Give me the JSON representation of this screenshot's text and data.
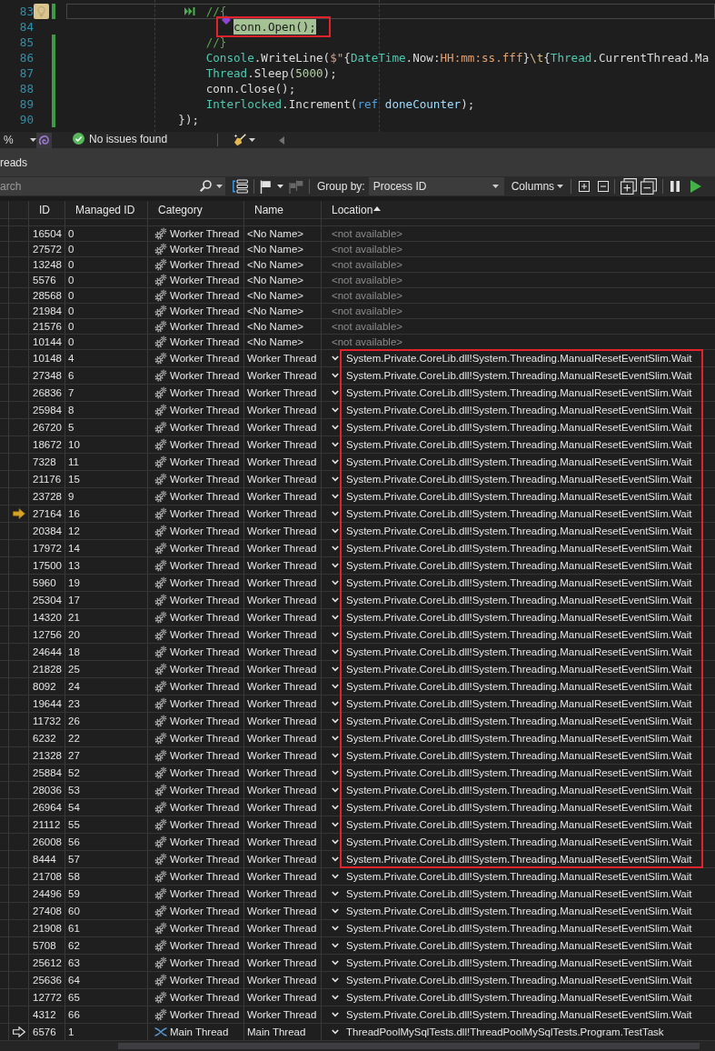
{
  "editor": {
    "lines": [
      {
        "children": [
          {
            "number": "83",
            "changed": true,
            "current": true,
            "highlighted": false,
            "annotated": false,
            "margin_tile": true,
            "run_to_click": true,
            "diamond": false,
            "tokens": [
              {
                "kind": "comment",
                "text": "//{"
              }
            ],
            "children": [
              {
                "number": "84",
                "changed": false,
                "current": false,
                "highlighted": true,
                "annotated": true,
                "margin_tile": false,
                "run_to_click": false,
                "diamond": true,
                "tokens": [
                  {
                    "kind": "plain",
                    "text": "conn.Open();"
                  }
                ]
              }
            ]
          },
          {
            "number": "85",
            "changed": true,
            "current": false,
            "highlighted": false,
            "annotated": false,
            "margin_tile": false,
            "run_to_click": false,
            "diamond": false,
            "tokens": [
              {
                "kind": "comment",
                "text": "//}"
              }
            ]
          },
          {
            "number": "86",
            "changed": true,
            "current": false,
            "highlighted": false,
            "annotated": false,
            "margin_tile": false,
            "run_to_click": false,
            "diamond": false,
            "tokens": [
              {
                "kind": "class",
                "text": "Console"
              },
              {
                "kind": "plain",
                "text": ".WriteLine("
              },
              {
                "kind": "string",
                "text": "$\""
              },
              {
                "kind": "plain",
                "text": "{"
              },
              {
                "kind": "class",
                "text": "DateTime"
              },
              {
                "kind": "plain",
                "text": ".Now:"
              },
              {
                "kind": "format",
                "text": "HH:mm:ss.fff"
              },
              {
                "kind": "plain",
                "text": "}"
              },
              {
                "kind": "escape",
                "text": "\\t"
              },
              {
                "kind": "plain",
                "text": "{"
              },
              {
                "kind": "class",
                "text": "Thread"
              },
              {
                "kind": "plain",
                "text": ".CurrentThread.Ma"
              }
            ]
          },
          {
            "number": "87",
            "changed": true,
            "current": false,
            "highlighted": false,
            "annotated": false,
            "margin_tile": false,
            "run_to_click": false,
            "diamond": false,
            "tokens": [
              {
                "kind": "class",
                "text": "Thread"
              },
              {
                "kind": "plain",
                "text": ".Sleep("
              },
              {
                "kind": "number",
                "text": "5000"
              },
              {
                "kind": "plain",
                "text": ");"
              }
            ]
          },
          {
            "number": "88",
            "changed": true,
            "current": false,
            "highlighted": false,
            "annotated": false,
            "margin_tile": false,
            "run_to_click": false,
            "diamond": false,
            "tokens": [
              {
                "kind": "plain",
                "text": "conn.Close();"
              }
            ]
          },
          {
            "number": "89",
            "changed": true,
            "current": false,
            "highlighted": false,
            "annotated": false,
            "margin_tile": false,
            "run_to_click": false,
            "diamond": false,
            "tokens": [
              {
                "kind": "class",
                "text": "Interlocked"
              },
              {
                "kind": "plain",
                "text": ".Increment("
              },
              {
                "kind": "keyword",
                "text": "ref "
              },
              {
                "kind": "variable",
                "text": "doneCounter"
              },
              {
                "kind": "plain",
                "text": ");"
              }
            ]
          }
        ]
      },
      {
        "number": "90",
        "changed": true,
        "current": false,
        "highlighted": false,
        "annotated": false,
        "margin_tile": false,
        "run_to_click": false,
        "diamond": false,
        "tokens": [
          {
            "kind": "plain",
            "text": "});"
          }
        ]
      }
    ]
  },
  "status_bar": {
    "zoom": "%",
    "issues": "No issues found"
  },
  "threads_window": {
    "title": "reads",
    "toolbar": {
      "search": {
        "placeholder": "arch"
      },
      "group_by": {
        "label": "Group by:",
        "value": "Process ID"
      },
      "columns_menu": {
        "label": "Columns"
      },
      "buttons": [
        {
          "disabled": false
        },
        {
          "disabled": false
        },
        {
          "disabled": true
        },
        {
          "disabled": false
        },
        {
          "disabled": false
        },
        {
          "disabled": false
        },
        {
          "disabled": false
        },
        {
          "disabled": false
        },
        {
          "disabled": false
        }
      ]
    },
    "table": {
      "columns": [
        {
          "label": "ID",
          "sorted": false
        },
        {
          "label": "Managed ID",
          "sorted": false
        },
        {
          "label": "Category",
          "sorted": false
        },
        {
          "label": "Name",
          "sorted": false
        },
        {
          "label": "Location",
          "sorted": true
        }
      ],
      "row_groups": [
        {
          "annotated": false,
          "rows": [
            {
              "id": "16504",
              "managed_id": "0",
              "kind": "worker",
              "category": "Worker Thread",
              "name": "<No Name>",
              "location": "<not available>",
              "expandable": false,
              "dimmed": true,
              "current": false,
              "break_thread": false
            },
            {
              "id": "27572",
              "managed_id": "0",
              "kind": "worker",
              "category": "Worker Thread",
              "name": "<No Name>",
              "location": "<not available>",
              "expandable": false,
              "dimmed": true,
              "current": false,
              "break_thread": false
            },
            {
              "id": "13248",
              "managed_id": "0",
              "kind": "worker",
              "category": "Worker Thread",
              "name": "<No Name>",
              "location": "<not available>",
              "expandable": false,
              "dimmed": true,
              "current": false,
              "break_thread": false
            },
            {
              "id": "5576",
              "managed_id": "0",
              "kind": "worker",
              "category": "Worker Thread",
              "name": "<No Name>",
              "location": "<not available>",
              "expandable": false,
              "dimmed": true,
              "current": false,
              "break_thread": false
            },
            {
              "id": "28568",
              "managed_id": "0",
              "kind": "worker",
              "category": "Worker Thread",
              "name": "<No Name>",
              "location": "<not available>",
              "expandable": false,
              "dimmed": true,
              "current": false,
              "break_thread": false
            },
            {
              "id": "21984",
              "managed_id": "0",
              "kind": "worker",
              "category": "Worker Thread",
              "name": "<No Name>",
              "location": "<not available>",
              "expandable": false,
              "dimmed": true,
              "current": false,
              "break_thread": false
            },
            {
              "id": "21576",
              "managed_id": "0",
              "kind": "worker",
              "category": "Worker Thread",
              "name": "<No Name>",
              "location": "<not available>",
              "expandable": false,
              "dimmed": true,
              "current": false,
              "break_thread": false
            },
            {
              "id": "10144",
              "managed_id": "0",
              "kind": "worker",
              "category": "Worker Thread",
              "name": "<No Name>",
              "location": "<not available>",
              "expandable": false,
              "dimmed": true,
              "current": false,
              "break_thread": false
            }
          ]
        },
        {
          "annotated": true,
          "rows": [
            {
              "id": "10148",
              "managed_id": "4",
              "kind": "worker",
              "category": "Worker Thread",
              "name": "Worker Thread",
              "location": "System.Private.CoreLib.dll!System.Threading.ManualResetEventSlim.Wait",
              "expandable": true,
              "dimmed": false,
              "current": false,
              "break_thread": false
            },
            {
              "id": "27348",
              "managed_id": "6",
              "kind": "worker",
              "category": "Worker Thread",
              "name": "Worker Thread",
              "location": "System.Private.CoreLib.dll!System.Threading.ManualResetEventSlim.Wait",
              "expandable": true,
              "dimmed": false,
              "current": false,
              "break_thread": false
            },
            {
              "id": "26836",
              "managed_id": "7",
              "kind": "worker",
              "category": "Worker Thread",
              "name": "Worker Thread",
              "location": "System.Private.CoreLib.dll!System.Threading.ManualResetEventSlim.Wait",
              "expandable": true,
              "dimmed": false,
              "current": false,
              "break_thread": false
            },
            {
              "id": "25984",
              "managed_id": "8",
              "kind": "worker",
              "category": "Worker Thread",
              "name": "Worker Thread",
              "location": "System.Private.CoreLib.dll!System.Threading.ManualResetEventSlim.Wait",
              "expandable": true,
              "dimmed": false,
              "current": false,
              "break_thread": false
            },
            {
              "id": "26720",
              "managed_id": "5",
              "kind": "worker",
              "category": "Worker Thread",
              "name": "Worker Thread",
              "location": "System.Private.CoreLib.dll!System.Threading.ManualResetEventSlim.Wait",
              "expandable": true,
              "dimmed": false,
              "current": false,
              "break_thread": false
            },
            {
              "id": "18672",
              "managed_id": "10",
              "kind": "worker",
              "category": "Worker Thread",
              "name": "Worker Thread",
              "location": "System.Private.CoreLib.dll!System.Threading.ManualResetEventSlim.Wait",
              "expandable": true,
              "dimmed": false,
              "current": false,
              "break_thread": false
            },
            {
              "id": "7328",
              "managed_id": "11",
              "kind": "worker",
              "category": "Worker Thread",
              "name": "Worker Thread",
              "location": "System.Private.CoreLib.dll!System.Threading.ManualResetEventSlim.Wait",
              "expandable": true,
              "dimmed": false,
              "current": false,
              "break_thread": false
            },
            {
              "id": "21176",
              "managed_id": "15",
              "kind": "worker",
              "category": "Worker Thread",
              "name": "Worker Thread",
              "location": "System.Private.CoreLib.dll!System.Threading.ManualResetEventSlim.Wait",
              "expandable": true,
              "dimmed": false,
              "current": false,
              "break_thread": false
            },
            {
              "id": "23728",
              "managed_id": "9",
              "kind": "worker",
              "category": "Worker Thread",
              "name": "Worker Thread",
              "location": "System.Private.CoreLib.dll!System.Threading.ManualResetEventSlim.Wait",
              "expandable": true,
              "dimmed": false,
              "current": false,
              "break_thread": false
            },
            {
              "id": "27164",
              "managed_id": "16",
              "kind": "worker",
              "category": "Worker Thread",
              "name": "Worker Thread",
              "location": "System.Private.CoreLib.dll!System.Threading.ManualResetEventSlim.Wait",
              "expandable": true,
              "dimmed": false,
              "current": true,
              "break_thread": false
            },
            {
              "id": "20384",
              "managed_id": "12",
              "kind": "worker",
              "category": "Worker Thread",
              "name": "Worker Thread",
              "location": "System.Private.CoreLib.dll!System.Threading.ManualResetEventSlim.Wait",
              "expandable": true,
              "dimmed": false,
              "current": false,
              "break_thread": false
            },
            {
              "id": "17972",
              "managed_id": "14",
              "kind": "worker",
              "category": "Worker Thread",
              "name": "Worker Thread",
              "location": "System.Private.CoreLib.dll!System.Threading.ManualResetEventSlim.Wait",
              "expandable": true,
              "dimmed": false,
              "current": false,
              "break_thread": false
            },
            {
              "id": "17500",
              "managed_id": "13",
              "kind": "worker",
              "category": "Worker Thread",
              "name": "Worker Thread",
              "location": "System.Private.CoreLib.dll!System.Threading.ManualResetEventSlim.Wait",
              "expandable": true,
              "dimmed": false,
              "current": false,
              "break_thread": false
            },
            {
              "id": "5960",
              "managed_id": "19",
              "kind": "worker",
              "category": "Worker Thread",
              "name": "Worker Thread",
              "location": "System.Private.CoreLib.dll!System.Threading.ManualResetEventSlim.Wait",
              "expandable": true,
              "dimmed": false,
              "current": false,
              "break_thread": false
            },
            {
              "id": "25304",
              "managed_id": "17",
              "kind": "worker",
              "category": "Worker Thread",
              "name": "Worker Thread",
              "location": "System.Private.CoreLib.dll!System.Threading.ManualResetEventSlim.Wait",
              "expandable": true,
              "dimmed": false,
              "current": false,
              "break_thread": false
            },
            {
              "id": "14320",
              "managed_id": "21",
              "kind": "worker",
              "category": "Worker Thread",
              "name": "Worker Thread",
              "location": "System.Private.CoreLib.dll!System.Threading.ManualResetEventSlim.Wait",
              "expandable": true,
              "dimmed": false,
              "current": false,
              "break_thread": false
            },
            {
              "id": "12756",
              "managed_id": "20",
              "kind": "worker",
              "category": "Worker Thread",
              "name": "Worker Thread",
              "location": "System.Private.CoreLib.dll!System.Threading.ManualResetEventSlim.Wait",
              "expandable": true,
              "dimmed": false,
              "current": false,
              "break_thread": false
            },
            {
              "id": "24644",
              "managed_id": "18",
              "kind": "worker",
              "category": "Worker Thread",
              "name": "Worker Thread",
              "location": "System.Private.CoreLib.dll!System.Threading.ManualResetEventSlim.Wait",
              "expandable": true,
              "dimmed": false,
              "current": false,
              "break_thread": false
            },
            {
              "id": "21828",
              "managed_id": "25",
              "kind": "worker",
              "category": "Worker Thread",
              "name": "Worker Thread",
              "location": "System.Private.CoreLib.dll!System.Threading.ManualResetEventSlim.Wait",
              "expandable": true,
              "dimmed": false,
              "current": false,
              "break_thread": false
            },
            {
              "id": "8092",
              "managed_id": "24",
              "kind": "worker",
              "category": "Worker Thread",
              "name": "Worker Thread",
              "location": "System.Private.CoreLib.dll!System.Threading.ManualResetEventSlim.Wait",
              "expandable": true,
              "dimmed": false,
              "current": false,
              "break_thread": false
            },
            {
              "id": "19644",
              "managed_id": "23",
              "kind": "worker",
              "category": "Worker Thread",
              "name": "Worker Thread",
              "location": "System.Private.CoreLib.dll!System.Threading.ManualResetEventSlim.Wait",
              "expandable": true,
              "dimmed": false,
              "current": false,
              "break_thread": false
            },
            {
              "id": "11732",
              "managed_id": "26",
              "kind": "worker",
              "category": "Worker Thread",
              "name": "Worker Thread",
              "location": "System.Private.CoreLib.dll!System.Threading.ManualResetEventSlim.Wait",
              "expandable": true,
              "dimmed": false,
              "current": false,
              "break_thread": false
            },
            {
              "id": "6232",
              "managed_id": "22",
              "kind": "worker",
              "category": "Worker Thread",
              "name": "Worker Thread",
              "location": "System.Private.CoreLib.dll!System.Threading.ManualResetEventSlim.Wait",
              "expandable": true,
              "dimmed": false,
              "current": false,
              "break_thread": false
            },
            {
              "id": "21328",
              "managed_id": "27",
              "kind": "worker",
              "category": "Worker Thread",
              "name": "Worker Thread",
              "location": "System.Private.CoreLib.dll!System.Threading.ManualResetEventSlim.Wait",
              "expandable": true,
              "dimmed": false,
              "current": false,
              "break_thread": false
            },
            {
              "id": "25884",
              "managed_id": "52",
              "kind": "worker",
              "category": "Worker Thread",
              "name": "Worker Thread",
              "location": "System.Private.CoreLib.dll!System.Threading.ManualResetEventSlim.Wait",
              "expandable": true,
              "dimmed": false,
              "current": false,
              "break_thread": false
            },
            {
              "id": "28036",
              "managed_id": "53",
              "kind": "worker",
              "category": "Worker Thread",
              "name": "Worker Thread",
              "location": "System.Private.CoreLib.dll!System.Threading.ManualResetEventSlim.Wait",
              "expandable": true,
              "dimmed": false,
              "current": false,
              "break_thread": false
            },
            {
              "id": "26964",
              "managed_id": "54",
              "kind": "worker",
              "category": "Worker Thread",
              "name": "Worker Thread",
              "location": "System.Private.CoreLib.dll!System.Threading.ManualResetEventSlim.Wait",
              "expandable": true,
              "dimmed": false,
              "current": false,
              "break_thread": false
            },
            {
              "id": "21112",
              "managed_id": "55",
              "kind": "worker",
              "category": "Worker Thread",
              "name": "Worker Thread",
              "location": "System.Private.CoreLib.dll!System.Threading.ManualResetEventSlim.Wait",
              "expandable": true,
              "dimmed": false,
              "current": false,
              "break_thread": false
            },
            {
              "id": "26008",
              "managed_id": "56",
              "kind": "worker",
              "category": "Worker Thread",
              "name": "Worker Thread",
              "location": "System.Private.CoreLib.dll!System.Threading.ManualResetEventSlim.Wait",
              "expandable": true,
              "dimmed": false,
              "current": false,
              "break_thread": false
            },
            {
              "id": "8444",
              "managed_id": "57",
              "kind": "worker",
              "category": "Worker Thread",
              "name": "Worker Thread",
              "location": "System.Private.CoreLib.dll!System.Threading.ManualResetEventSlim.Wait",
              "expandable": true,
              "dimmed": false,
              "current": false,
              "break_thread": false
            }
          ]
        },
        {
          "annotated": false,
          "rows": [
            {
              "id": "21708",
              "managed_id": "58",
              "kind": "worker",
              "category": "Worker Thread",
              "name": "Worker Thread",
              "location": "System.Private.CoreLib.dll!System.Threading.ManualResetEventSlim.Wait",
              "expandable": true,
              "dimmed": false,
              "current": false,
              "break_thread": false
            },
            {
              "id": "24496",
              "managed_id": "59",
              "kind": "worker",
              "category": "Worker Thread",
              "name": "Worker Thread",
              "location": "System.Private.CoreLib.dll!System.Threading.ManualResetEventSlim.Wait",
              "expandable": true,
              "dimmed": false,
              "current": false,
              "break_thread": false
            },
            {
              "id": "27408",
              "managed_id": "60",
              "kind": "worker",
              "category": "Worker Thread",
              "name": "Worker Thread",
              "location": "System.Private.CoreLib.dll!System.Threading.ManualResetEventSlim.Wait",
              "expandable": true,
              "dimmed": false,
              "current": false,
              "break_thread": false
            },
            {
              "id": "21908",
              "managed_id": "61",
              "kind": "worker",
              "category": "Worker Thread",
              "name": "Worker Thread",
              "location": "System.Private.CoreLib.dll!System.Threading.ManualResetEventSlim.Wait",
              "expandable": true,
              "dimmed": false,
              "current": false,
              "break_thread": false
            },
            {
              "id": "5708",
              "managed_id": "62",
              "kind": "worker",
              "category": "Worker Thread",
              "name": "Worker Thread",
              "location": "System.Private.CoreLib.dll!System.Threading.ManualResetEventSlim.Wait",
              "expandable": true,
              "dimmed": false,
              "current": false,
              "break_thread": false
            },
            {
              "id": "25612",
              "managed_id": "63",
              "kind": "worker",
              "category": "Worker Thread",
              "name": "Worker Thread",
              "location": "System.Private.CoreLib.dll!System.Threading.ManualResetEventSlim.Wait",
              "expandable": true,
              "dimmed": false,
              "current": false,
              "break_thread": false
            },
            {
              "id": "25636",
              "managed_id": "64",
              "kind": "worker",
              "category": "Worker Thread",
              "name": "Worker Thread",
              "location": "System.Private.CoreLib.dll!System.Threading.ManualResetEventSlim.Wait",
              "expandable": true,
              "dimmed": false,
              "current": false,
              "break_thread": false
            },
            {
              "id": "12772",
              "managed_id": "65",
              "kind": "worker",
              "category": "Worker Thread",
              "name": "Worker Thread",
              "location": "System.Private.CoreLib.dll!System.Threading.ManualResetEventSlim.Wait",
              "expandable": true,
              "dimmed": false,
              "current": false,
              "break_thread": false
            },
            {
              "id": "4312",
              "managed_id": "66",
              "kind": "worker",
              "category": "Worker Thread",
              "name": "Worker Thread",
              "location": "System.Private.CoreLib.dll!System.Threading.ManualResetEventSlim.Wait",
              "expandable": true,
              "dimmed": false,
              "current": false,
              "break_thread": false
            },
            {
              "id": "6576",
              "managed_id": "1",
              "kind": "main",
              "category": "Main Thread",
              "name": "Main Thread",
              "location": "ThreadPoolMySqlTests.dll!ThreadPoolMySqlTests.Program.TestTask",
              "expandable": true,
              "dimmed": false,
              "current": false,
              "break_thread": true
            }
          ]
        }
      ]
    }
  }
}
